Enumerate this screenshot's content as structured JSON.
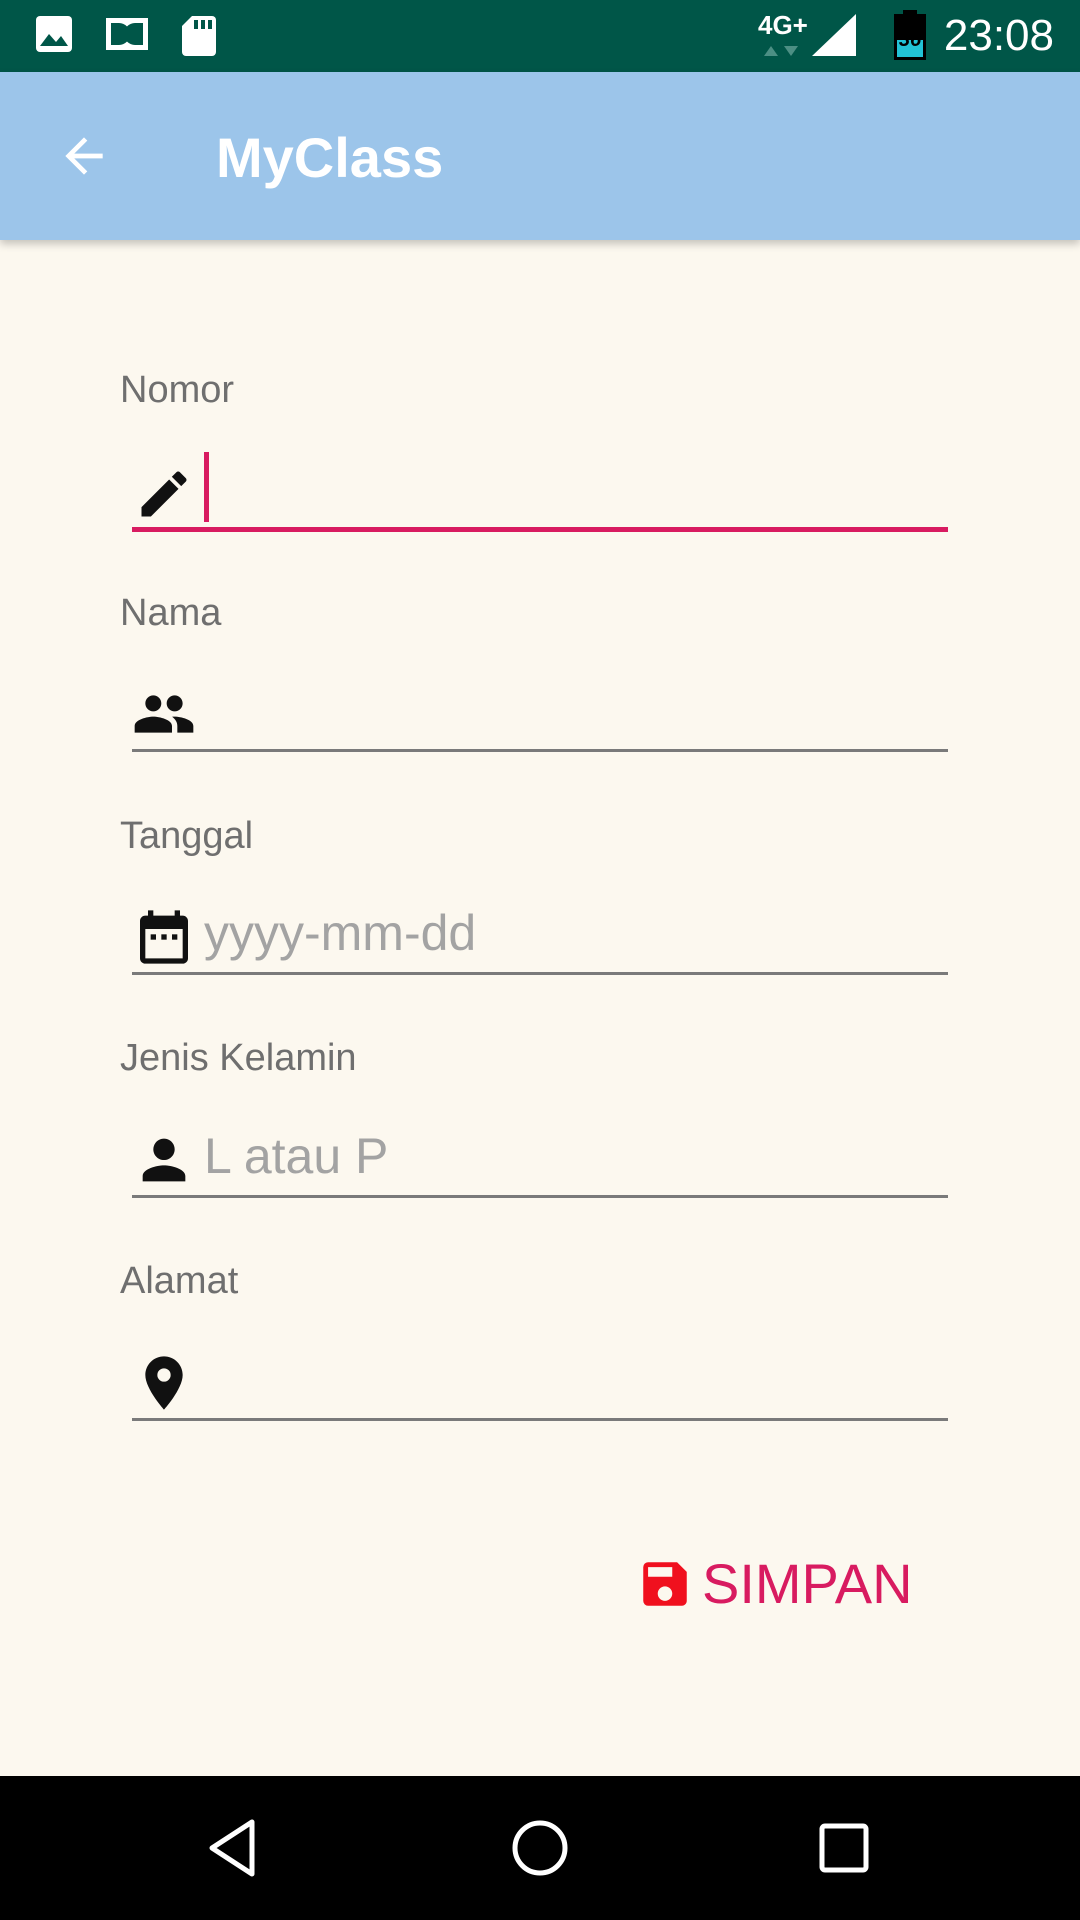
{
  "status_bar": {
    "time": "23:08",
    "network": "4G+",
    "battery_level": "36",
    "icons": [
      "image-icon",
      "dolby-icon",
      "sd-card-icon",
      "signal-icon",
      "battery-icon"
    ]
  },
  "app_bar": {
    "title": "MyClass",
    "back_icon": "arrow-back-icon"
  },
  "form": {
    "fields": [
      {
        "label": "Nomor",
        "value": "",
        "placeholder": "",
        "icon": "pencil-icon",
        "focused": true
      },
      {
        "label": "Nama",
        "value": "",
        "placeholder": "",
        "icon": "people-icon"
      },
      {
        "label": "Tanggal",
        "value": "",
        "placeholder": "yyyy-mm-dd",
        "icon": "calendar-icon"
      },
      {
        "label": "Jenis Kelamin",
        "value": "",
        "placeholder": "L atau P",
        "icon": "person-icon"
      },
      {
        "label": "Alamat",
        "value": "",
        "placeholder": "",
        "icon": "location-pin-icon"
      }
    ]
  },
  "save_button": {
    "label": "SIMPAN",
    "icon": "save-icon"
  },
  "nav_bar": {
    "icons": [
      "back-triangle-icon",
      "home-circle-icon",
      "recents-square-icon"
    ]
  },
  "colors": {
    "status_bar": "#005648",
    "app_bar": "#9cc5ea",
    "background": "#fcf8ef",
    "accent": "#d81b60",
    "save_icon": "#f0101e",
    "underline": "#7a7a7a"
  }
}
